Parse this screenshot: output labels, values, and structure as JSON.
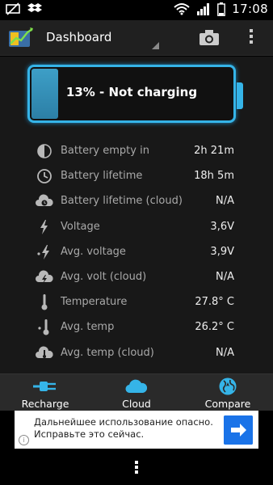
{
  "status_bar": {
    "time": "17:08",
    "icons": [
      "no-sim-icon",
      "dropbox-icon",
      "wifi-icon",
      "signal-icon",
      "battery-icon"
    ]
  },
  "header": {
    "title": "Dashboard",
    "actions": [
      "camera-icon",
      "overflow-menu-icon"
    ]
  },
  "battery": {
    "status_text": "13% - Not charging",
    "level_fraction": 0.13,
    "color": "#35b4e8"
  },
  "stats": [
    {
      "icon": "half-circle-icon",
      "label": "Battery empty in",
      "value": "2h 21m"
    },
    {
      "icon": "clock-icon",
      "label": "Battery lifetime",
      "value": "18h 5m"
    },
    {
      "icon": "cloud-clock-icon",
      "label": "Battery lifetime (cloud)",
      "value": "N/A"
    },
    {
      "icon": "bolt-icon",
      "label": "Voltage",
      "value": "3,6V"
    },
    {
      "icon": "avg-bolt-icon",
      "label": "Avg. voltage",
      "value": "3,9V"
    },
    {
      "icon": "cloud-bolt-icon",
      "label": "Avg. volt (cloud)",
      "value": "N/A"
    },
    {
      "icon": "thermometer-icon",
      "label": "Temperature",
      "value": "27.8° C"
    },
    {
      "icon": "avg-thermometer-icon",
      "label": "Avg. temp",
      "value": "26.2° C"
    },
    {
      "icon": "cloud-thermometer-icon",
      "label": "Avg. temp (cloud)",
      "value": "N/A"
    }
  ],
  "bottom_nav": [
    {
      "icon": "plug-icon",
      "label": "Recharge"
    },
    {
      "icon": "cloud-icon",
      "label": "Cloud"
    },
    {
      "icon": "globe-icon",
      "label": "Compare"
    }
  ],
  "ad": {
    "text_line1": "Дальнейшее использование опасно.",
    "text_line2": "Исправьте это сейчас.",
    "info_glyph": "i"
  },
  "colors": {
    "accent": "#35b4e8",
    "ad_button": "#1a73e8"
  }
}
